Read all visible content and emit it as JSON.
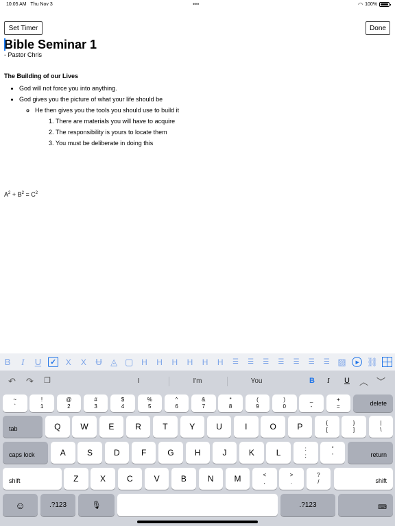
{
  "status": {
    "time": "10:05 AM",
    "date": "Thu Nov 3",
    "battery": "100%"
  },
  "top": {
    "set_timer": "Set Timer",
    "done": "Done"
  },
  "doc": {
    "title": "Bible Seminar 1",
    "subtitle": "- Pastor Chris",
    "section": "The Building of our Lives",
    "bullets": [
      "God will not force you into anything.",
      "God gives you the picture of what your life should be"
    ],
    "sub_bullet": "He then gives you the tools you should use to build it",
    "numbered": [
      "There are materials you will have to acquire",
      "The responsibility is yours to locate them",
      "You must be deliberate in doing this"
    ],
    "formula": {
      "a": "A",
      "b": "B",
      "c": "C",
      "exp": "2",
      "plus": " + ",
      "eq": " = "
    }
  },
  "toolbar": {
    "tools": [
      {
        "name": "bold-icon",
        "glyph": "B"
      },
      {
        "name": "italic-icon",
        "glyph": "I"
      },
      {
        "name": "underline-icon",
        "glyph": "U"
      },
      {
        "name": "checkbox-icon",
        "glyph": "✓"
      },
      {
        "name": "subscript-icon",
        "glyph": "X"
      },
      {
        "name": "superscript-icon",
        "glyph": "X"
      },
      {
        "name": "strikethrough-icon",
        "glyph": "U"
      },
      {
        "name": "text-color-icon",
        "glyph": "◬"
      },
      {
        "name": "highlight-icon",
        "glyph": "▢"
      },
      {
        "name": "heading1-icon",
        "glyph": "H"
      },
      {
        "name": "heading2-icon",
        "glyph": "H"
      },
      {
        "name": "heading3-icon",
        "glyph": "H"
      },
      {
        "name": "heading4-icon",
        "glyph": "H"
      },
      {
        "name": "heading5-icon",
        "glyph": "H"
      },
      {
        "name": "heading6-icon",
        "glyph": "H"
      },
      {
        "name": "bullet-list-icon",
        "glyph": "☰"
      },
      {
        "name": "numbered-list-icon",
        "glyph": "☰"
      },
      {
        "name": "indent-icon",
        "glyph": "☰"
      },
      {
        "name": "outdent-icon",
        "glyph": "☰"
      },
      {
        "name": "align-left-icon",
        "glyph": "☰"
      },
      {
        "name": "align-center-icon",
        "glyph": "☰"
      },
      {
        "name": "align-right-icon",
        "glyph": "☰"
      },
      {
        "name": "image-icon",
        "glyph": "▨"
      },
      {
        "name": "play-icon",
        "glyph": "▶"
      },
      {
        "name": "link-icon",
        "glyph": "⛓"
      },
      {
        "name": "table-icon",
        "glyph": ""
      }
    ]
  },
  "keyboard": {
    "suggestions": [
      "I",
      "I'm",
      "You"
    ],
    "format": {
      "bold": "B",
      "italic": "I",
      "underline": "U"
    },
    "row1": [
      {
        "top": "~",
        "bottom": "`"
      },
      {
        "top": "!",
        "bottom": "1"
      },
      {
        "top": "@",
        "bottom": "2"
      },
      {
        "top": "#",
        "bottom": "3"
      },
      {
        "top": "$",
        "bottom": "4"
      },
      {
        "top": "%",
        "bottom": "5"
      },
      {
        "top": "^",
        "bottom": "6"
      },
      {
        "top": "&",
        "bottom": "7"
      },
      {
        "top": "*",
        "bottom": "8"
      },
      {
        "top": "(",
        "bottom": "9"
      },
      {
        "top": ")",
        "bottom": "0"
      },
      {
        "top": "_",
        "bottom": "-"
      },
      {
        "top": "+",
        "bottom": "="
      }
    ],
    "delete": "delete",
    "tab": "tab",
    "row2": [
      "Q",
      "W",
      "E",
      "R",
      "T",
      "Y",
      "U",
      "I",
      "O",
      "P"
    ],
    "row2_extra": [
      {
        "top": "{",
        "bottom": "["
      },
      {
        "top": "}",
        "bottom": "]"
      },
      {
        "top": "|",
        "bottom": "\\"
      }
    ],
    "caps": "caps lock",
    "row3": [
      "A",
      "S",
      "D",
      "F",
      "G",
      "H",
      "J",
      "K",
      "L"
    ],
    "row3_extra": [
      {
        "top": ":",
        "bottom": ";"
      },
      {
        "top": "\"",
        "bottom": "'"
      }
    ],
    "return": "return",
    "shift": "shift",
    "row4": [
      "Z",
      "X",
      "C",
      "V",
      "B",
      "N",
      "M"
    ],
    "row4_extra": [
      {
        "top": "<",
        "bottom": ","
      },
      {
        "top": ">",
        "bottom": "."
      },
      {
        "top": "?",
        "bottom": "/"
      }
    ],
    "numbers": ".?123",
    "emoji": "☺",
    "mic": "🎙",
    "hide": "⌨"
  }
}
